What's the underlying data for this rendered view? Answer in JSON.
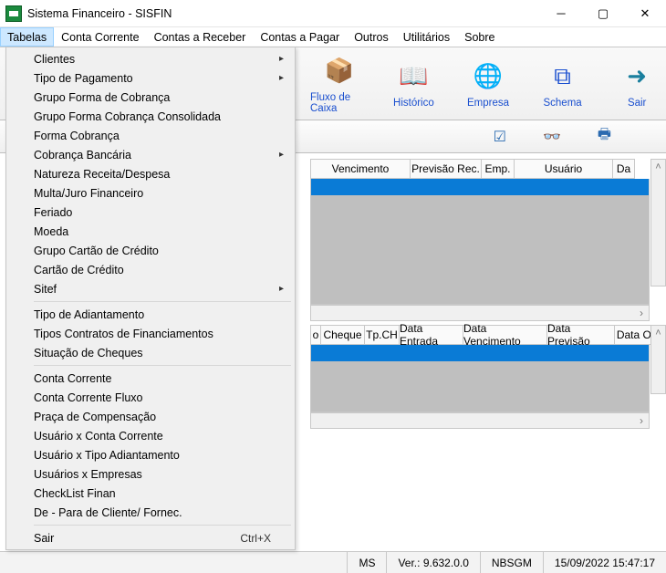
{
  "window": {
    "title": "Sistema Financeiro - SISFIN"
  },
  "menubar": {
    "items": [
      "Tabelas",
      "Conta Corrente",
      "Contas a Receber",
      "Contas a Pagar",
      "Outros",
      "Utilitários",
      "Sobre"
    ],
    "active": 0
  },
  "tabelas_menu": {
    "groups": [
      [
        {
          "label": "Clientes",
          "submenu": true
        },
        {
          "label": "Tipo de Pagamento",
          "submenu": true
        },
        {
          "label": "Grupo Forma de Cobrança"
        },
        {
          "label": "Grupo Forma Cobrança Consolidada"
        },
        {
          "label": "Forma Cobrança"
        },
        {
          "label": "Cobrança Bancária",
          "submenu": true
        },
        {
          "label": "Natureza Receita/Despesa"
        },
        {
          "label": "Multa/Juro Financeiro"
        },
        {
          "label": "Feriado"
        },
        {
          "label": "Moeda"
        },
        {
          "label": "Grupo Cartão de Crédito"
        },
        {
          "label": "Cartão de Crédito"
        },
        {
          "label": "Sitef",
          "submenu": true
        }
      ],
      [
        {
          "label": "Tipo de Adiantamento"
        },
        {
          "label": "Tipos Contratos de Financiamentos"
        },
        {
          "label": "Situação de Cheques"
        }
      ],
      [
        {
          "label": "Conta Corrente"
        },
        {
          "label": "Conta Corrente Fluxo"
        },
        {
          "label": "Praça de Compensação"
        },
        {
          "label": "Usuário x Conta Corrente"
        },
        {
          "label": "Usuário x Tipo Adiantamento"
        },
        {
          "label": "Usuários x Empresas"
        },
        {
          "label": "CheckList Finan"
        },
        {
          "label": "De - Para de Cliente/ Fornec."
        }
      ],
      [
        {
          "label": "Sair",
          "accel": "Ctrl+X"
        }
      ]
    ]
  },
  "toolbar": {
    "buttons": [
      {
        "id": "fluxo-caixa",
        "label": "Fluxo de Caixa",
        "icon": "📦"
      },
      {
        "id": "historico",
        "label": "Histórico",
        "icon": "📖"
      },
      {
        "id": "empresa",
        "label": "Empresa",
        "icon": "🌐"
      },
      {
        "id": "schema",
        "label": "Schema",
        "icon": "⧉"
      },
      {
        "id": "sair",
        "label": "Sair",
        "icon": "➜"
      }
    ]
  },
  "filter_icons": {
    "check": "☑",
    "glasses": "👓",
    "print": "🖶"
  },
  "grid1": {
    "cols": [
      "Vencimento",
      "Previsão Rec.",
      "Emp.",
      "Usuário",
      "Da"
    ]
  },
  "grid2": {
    "cols": [
      "o",
      "Cheque",
      "Tp.CH",
      "Data Entrada",
      "Data Vencimento",
      "Data Previsão",
      "Data Ocorrê"
    ]
  },
  "status": {
    "code": "MS",
    "version_label": "Ver.:",
    "version": "9.632.0.0",
    "host": "NBSGM",
    "datetime": "15/09/2022 15:47:17"
  }
}
